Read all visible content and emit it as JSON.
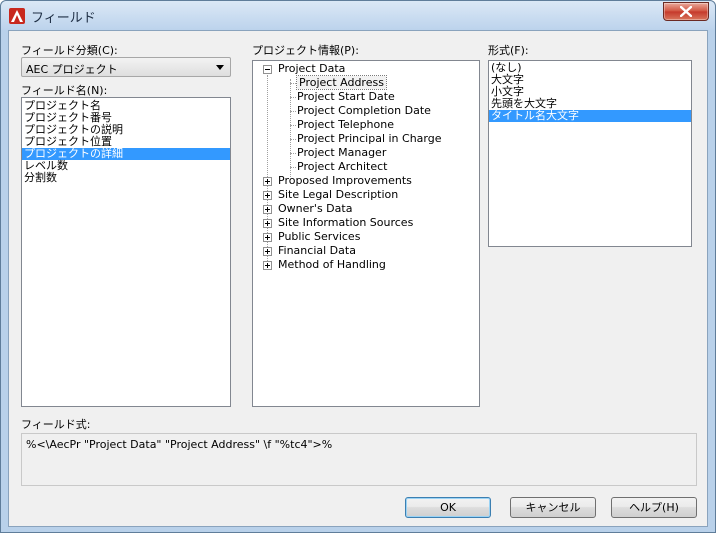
{
  "window": {
    "title": "フィールド",
    "close_icon": "close-icon"
  },
  "left": {
    "category_label": "フィールド分類(C):",
    "category_value": "AEC プロジェクト",
    "fieldname_label": "フィールド名(N):",
    "fieldnames": [
      {
        "label": "プロジェクト名",
        "selected": false
      },
      {
        "label": "プロジェクト番号",
        "selected": false
      },
      {
        "label": "プロジェクトの説明",
        "selected": false
      },
      {
        "label": "プロジェクト位置",
        "selected": false
      },
      {
        "label": "プロジェクトの詳細",
        "selected": true
      },
      {
        "label": "レベル数",
        "selected": false
      },
      {
        "label": "分割数",
        "selected": false
      }
    ]
  },
  "middle": {
    "label": "プロジェクト情報(P):",
    "tree": {
      "root": {
        "label": "Project Data",
        "expanded": true
      },
      "children": [
        {
          "label": "Project Address",
          "focused": true
        },
        {
          "label": "Project Start Date"
        },
        {
          "label": "Project Completion Date"
        },
        {
          "label": "Project Telephone"
        },
        {
          "label": "Project Principal in Charge"
        },
        {
          "label": "Project Manager"
        },
        {
          "label": "Project Architect"
        }
      ],
      "collapsed": [
        {
          "label": "Proposed Improvements"
        },
        {
          "label": "Site Legal Description"
        },
        {
          "label": "Owner's Data"
        },
        {
          "label": "Site Information Sources"
        },
        {
          "label": "Public Services"
        },
        {
          "label": "Financial Data"
        },
        {
          "label": "Method of Handling"
        }
      ]
    }
  },
  "right": {
    "label": "形式(F):",
    "formats": [
      {
        "label": "(なし)",
        "selected": false
      },
      {
        "label": "大文字",
        "selected": false
      },
      {
        "label": "小文字",
        "selected": false
      },
      {
        "label": "先頭を大文字",
        "selected": false
      },
      {
        "label": "タイトル名大文字",
        "selected": true
      }
    ]
  },
  "expression": {
    "label": "フィールド式:",
    "value": "%<\\AecPr \"Project Data\" \"Project Address\" \\f \"%tc4\">%"
  },
  "buttons": {
    "ok": "OK",
    "cancel": "キャンセル",
    "help": "ヘルプ(H)"
  },
  "colors": {
    "selection": "#3399ff",
    "app_icon": "#c8281e"
  }
}
